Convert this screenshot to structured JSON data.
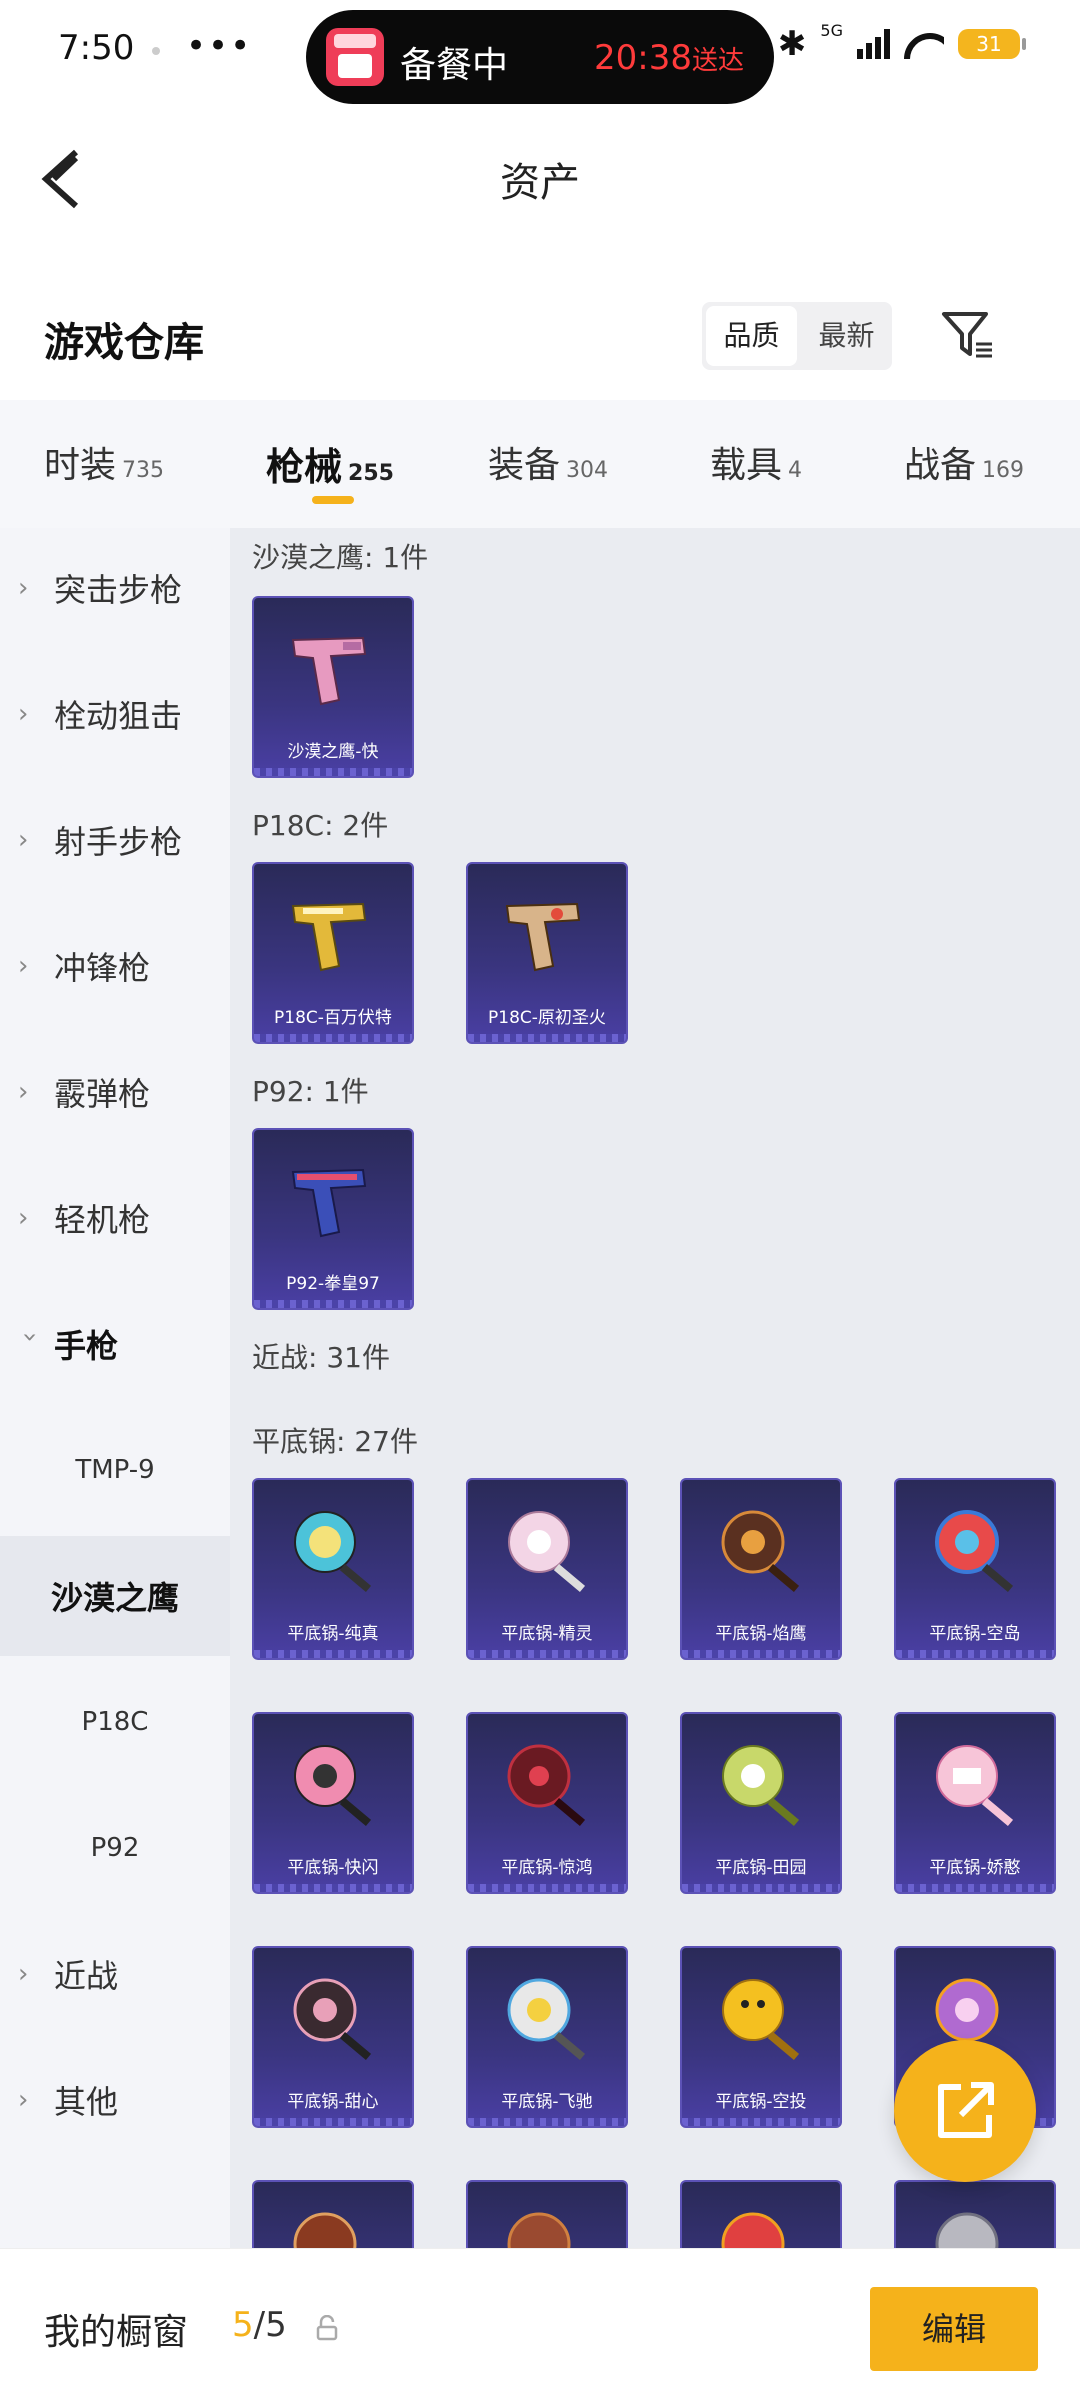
{
  "status_bar": {
    "time": "7:50",
    "more": "•••",
    "activity_text": "备餐中",
    "activity_eta": "20:38",
    "activity_eta_suffix": "送达",
    "network": "5G",
    "battery": "31"
  },
  "header": {
    "title": "资产"
  },
  "warehouse": {
    "title": "游戏仓库",
    "sort_options": [
      "品质",
      "最新"
    ],
    "active_sort": "品质"
  },
  "tabs": [
    {
      "label": "时装",
      "count": "735"
    },
    {
      "label": "枪械",
      "count": "255",
      "active": true
    },
    {
      "label": "装备",
      "count": "304"
    },
    {
      "label": "载具",
      "count": "4"
    },
    {
      "label": "战备",
      "count": "169"
    }
  ],
  "sidebar": {
    "items": [
      {
        "label": "突击步枪"
      },
      {
        "label": "栓动狙击"
      },
      {
        "label": "射手步枪"
      },
      {
        "label": "冲锋枪"
      },
      {
        "label": "霰弹枪"
      },
      {
        "label": "轻机枪"
      },
      {
        "label": "手枪"
      },
      {
        "label": "TMP-9"
      },
      {
        "label": "沙漠之鹰"
      },
      {
        "label": "P18C"
      },
      {
        "label": "P92"
      },
      {
        "label": "近战"
      },
      {
        "label": "其他"
      }
    ]
  },
  "sections": {
    "deagle": {
      "title": "沙漠之鹰: 1件",
      "items": [
        "沙漠之鹰-快"
      ]
    },
    "p18c": {
      "title": "P18C: 2件",
      "items": [
        "P18C-百万伏特",
        "P18C-原初圣火"
      ]
    },
    "p92": {
      "title": "P92: 1件",
      "items": [
        "P92-拳皇97"
      ]
    },
    "melee": {
      "title": "近战: 31件"
    },
    "pan": {
      "title": "平底锅: 27件",
      "items": [
        "平底锅-纯真",
        "平底锅-精灵",
        "平底锅-焰鹰",
        "平底锅-空岛",
        "平底锅-快闪",
        "平底锅-惊鸿",
        "平底锅-田园",
        "平底锅-娇憨",
        "平底锅-甜心",
        "平底锅-飞驰",
        "平底锅-空投"
      ]
    }
  },
  "bottom": {
    "shop_label": "我的橱窗",
    "shop_current": "5",
    "shop_total": "/5",
    "edit_label": "编辑"
  },
  "colors": {
    "accent": "#f5b21b",
    "card_bg": "#3a3580"
  }
}
